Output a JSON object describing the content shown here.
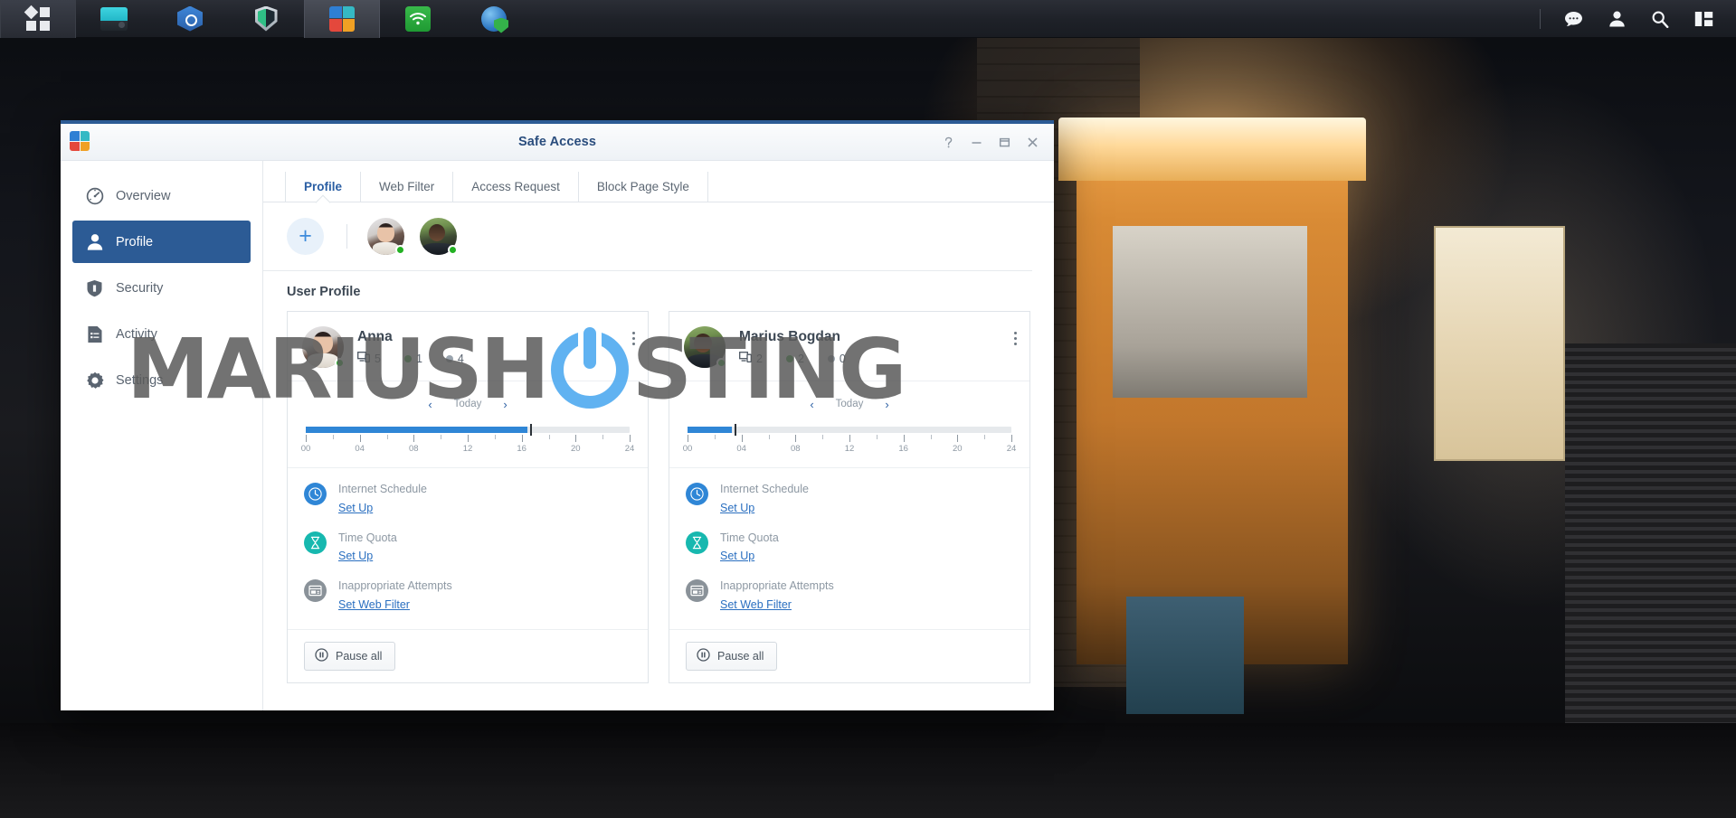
{
  "taskbar": {
    "apps": [
      {
        "name": "main-menu",
        "icon": "grid-squares-icon",
        "active": false
      },
      {
        "name": "dsm-window",
        "icon": "monitor-icon",
        "active": false
      },
      {
        "name": "network-center",
        "icon": "network-hex-icon",
        "active": false
      },
      {
        "name": "security-shield",
        "icon": "shield-icon",
        "active": false
      },
      {
        "name": "safe-access",
        "icon": "safe-access-icon",
        "active": true
      },
      {
        "name": "wifi",
        "icon": "wifi-icon",
        "active": false
      },
      {
        "name": "security-advisor",
        "icon": "globe-shield-icon",
        "active": false
      }
    ],
    "right_icons": [
      {
        "name": "notifications",
        "icon": "chat-bubble-icon"
      },
      {
        "name": "account",
        "icon": "person-icon"
      },
      {
        "name": "search",
        "icon": "magnifier-icon"
      },
      {
        "name": "widgets",
        "icon": "panel-layout-icon"
      }
    ]
  },
  "window": {
    "title": "Safe Access",
    "app_icon": "safe-access-icon",
    "controls": [
      {
        "name": "help-button",
        "glyph": "?"
      },
      {
        "name": "minimize-button",
        "glyph": "—"
      },
      {
        "name": "maximize-button",
        "glyph": "❐"
      },
      {
        "name": "close-button",
        "glyph": "✕"
      }
    ]
  },
  "sidebar": {
    "items": [
      {
        "label": "Overview",
        "icon": "speedometer-icon",
        "active": false
      },
      {
        "label": "Profile",
        "icon": "person-icon",
        "active": true
      },
      {
        "label": "Security",
        "icon": "shield-icon",
        "active": false
      },
      {
        "label": "Activity",
        "icon": "document-list-icon",
        "active": false
      },
      {
        "label": "Settings",
        "icon": "gear-icon",
        "active": false
      }
    ]
  },
  "tabs": [
    {
      "label": "Profile",
      "active": true
    },
    {
      "label": "Web Filter",
      "active": false
    },
    {
      "label": "Access Request",
      "active": false
    },
    {
      "label": "Block Page Style",
      "active": false
    }
  ],
  "avatar_strip": {
    "add_label": "+",
    "avatars": [
      {
        "name": "Anna",
        "status": "online"
      },
      {
        "name": "Marius Bogdan",
        "status": "online"
      }
    ]
  },
  "section_title": "User Profile",
  "timeline": {
    "nav_label": "Today",
    "prev_glyph": "‹",
    "next_glyph": "›",
    "hour_labels": [
      "00",
      "04",
      "08",
      "12",
      "16",
      "20",
      "24"
    ],
    "axis_min": 0,
    "axis_max": 24
  },
  "cards": [
    {
      "name": "Anna",
      "status": "online",
      "devices": "5",
      "online": "1",
      "offline": "0",
      "offline_count": "4",
      "timeline": {
        "fill_start": 0,
        "fill_end": 16.4,
        "now": 16.6
      },
      "quick_actions": [
        {
          "title": "Internet Schedule",
          "link": "Set Up",
          "icon": "clock-icon",
          "color": "#2f86d6"
        },
        {
          "title": "Time Quota",
          "link": "Set Up",
          "icon": "hourglass-icon",
          "color": "#17b8af"
        },
        {
          "title": "Inappropriate Attempts",
          "link": "Set Web Filter",
          "icon": "browser-window-icon",
          "color": "#8a9299"
        }
      ],
      "pause_label": "Pause all"
    },
    {
      "name": "Marius Bogdan",
      "status": "online",
      "devices": "2",
      "online": "2",
      "offline_count": "0",
      "timeline": {
        "fill_start": 0,
        "fill_end": 3.3,
        "now": 3.5
      },
      "quick_actions": [
        {
          "title": "Internet Schedule",
          "link": "Set Up",
          "icon": "clock-icon",
          "color": "#2f86d6"
        },
        {
          "title": "Time Quota",
          "link": "Set Up",
          "icon": "hourglass-icon",
          "color": "#17b8af"
        },
        {
          "title": "Inappropriate Attempts",
          "link": "Set Web Filter",
          "icon": "browser-window-icon",
          "color": "#8a9299"
        }
      ],
      "pause_label": "Pause all"
    }
  ],
  "watermark": {
    "text_left": "MARIUSH",
    "text_right": "STING"
  },
  "colors": {
    "accent": "#2c5b95",
    "link": "#2a6fc0",
    "online": "#23b123",
    "offline": "#9aa4ae",
    "timeline_fill": "#2f86d6"
  }
}
